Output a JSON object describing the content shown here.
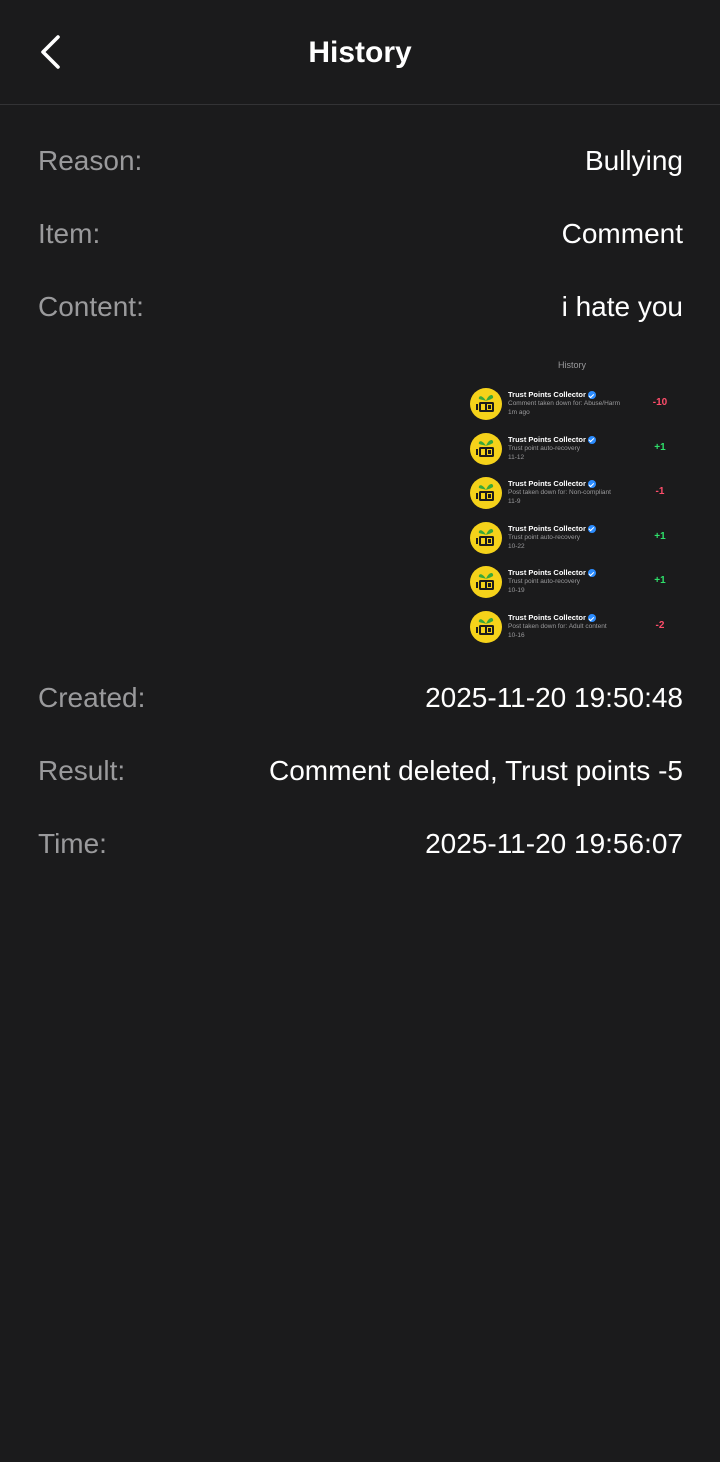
{
  "header": {
    "title": "History",
    "back_icon": "chevron-left-icon"
  },
  "details": {
    "reason": {
      "label": "Reason:",
      "value": "Bullying"
    },
    "item": {
      "label": "Item:",
      "value": "Comment"
    },
    "content": {
      "label": "Content:",
      "value": "i hate you"
    },
    "created": {
      "label": "Created:",
      "value": "2025-11-20 19:50:48"
    },
    "result": {
      "label": "Result:",
      "value": "Comment deleted, Trust points -5"
    },
    "time": {
      "label": "Time:",
      "value": "2025-11-20 19:56:07"
    }
  },
  "attachment": {
    "title": "History",
    "entries": [
      {
        "name": "Trust Points Collector",
        "desc": "Comment taken down for: Abuse/Harm",
        "date": "1m ago",
        "delta": "-10",
        "sign": "neg"
      },
      {
        "name": "Trust Points Collector",
        "desc": "Trust point auto-recovery",
        "date": "11-12",
        "delta": "+1",
        "sign": "pos"
      },
      {
        "name": "Trust Points Collector",
        "desc": "Post taken down for: Non-compliant",
        "date": "11-9",
        "delta": "-1",
        "sign": "neg"
      },
      {
        "name": "Trust Points Collector",
        "desc": "Trust point auto-recovery",
        "date": "10-22",
        "delta": "+1",
        "sign": "pos"
      },
      {
        "name": "Trust Points Collector",
        "desc": "Trust point auto-recovery",
        "date": "10-19",
        "delta": "+1",
        "sign": "pos"
      },
      {
        "name": "Trust Points Collector",
        "desc": "Post taken down for: Adult content",
        "date": "10-16",
        "delta": "-2",
        "sign": "neg"
      }
    ]
  },
  "colors": {
    "background": "#1b1b1c",
    "label": "#9a9a9c",
    "value": "#ffffff",
    "negative": "#ff4d6a",
    "positive": "#2ee06a",
    "avatar": "#f5d21a",
    "verified": "#2b8cff"
  }
}
